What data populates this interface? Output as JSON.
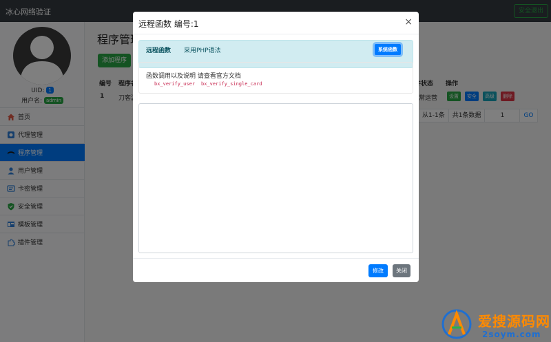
{
  "navbar": {
    "brand": "冰心网络验证",
    "logout_label": "安全退出"
  },
  "sidebar": {
    "uid_label": "UID:",
    "uid_value": "1",
    "username_label": "用户名:",
    "username_value": "admin",
    "items": [
      {
        "label": "首页",
        "icon": "home-icon",
        "active": false
      },
      {
        "label": "代理管理",
        "icon": "agent-icon",
        "active": false
      },
      {
        "label": "程序管理",
        "icon": "program-icon",
        "active": true
      },
      {
        "label": "用户管理",
        "icon": "user-icon",
        "active": false
      },
      {
        "label": "卡密管理",
        "icon": "card-icon",
        "active": false
      },
      {
        "label": "安全管理",
        "icon": "shield-icon",
        "active": false
      },
      {
        "label": "模板管理",
        "icon": "template-icon",
        "active": false
      },
      {
        "label": "插件管理",
        "icon": "plugin-icon",
        "active": false
      }
    ]
  },
  "main": {
    "page_title": "程序管理",
    "add_button": "添加程序",
    "table": {
      "headers": {
        "id": "编号",
        "name": "程序名",
        "status": "件状态",
        "actions": "操作"
      },
      "rows": [
        {
          "id": "1",
          "name": "刀客源",
          "status": "常运营",
          "buttons": [
            "设置",
            "安全",
            "高级",
            "删除"
          ]
        }
      ]
    },
    "pagination": {
      "range": "从1-1条",
      "total": "共1条数据",
      "page": "1",
      "go": "GO"
    }
  },
  "modal": {
    "title": "远程函数 编号:1",
    "close_symbol": "×",
    "alert_strong": "远程函数",
    "alert_text": "采用PHP语法",
    "system_button": "系统函数",
    "doc_title": "函数调用以及说明 请查看官方文档",
    "functions": [
      "bx_verify_user",
      "bx_verify_single_card"
    ],
    "textarea_value": "",
    "edit_button": "修改",
    "close_button": "关闭"
  },
  "watermark": {
    "title": "爱搜源码网",
    "subtitle": "2soym.com"
  },
  "colors": {
    "primary": "#007bff",
    "success": "#28a745",
    "danger": "#dc3545",
    "info": "#17a2b8",
    "navbar": "#343a40"
  }
}
